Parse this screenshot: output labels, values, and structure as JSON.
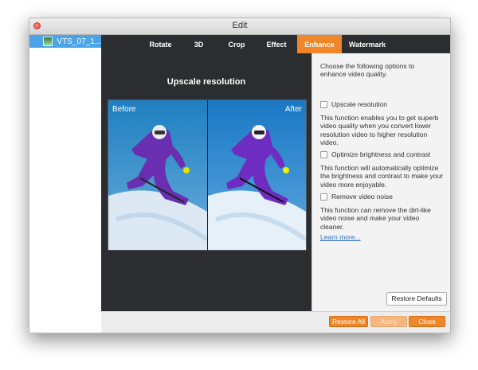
{
  "window": {
    "title": "Edit"
  },
  "sidebar": {
    "items": [
      {
        "label": "VTS_07_1..."
      }
    ]
  },
  "tabs": [
    {
      "label": "Rotate",
      "active": false
    },
    {
      "label": "3D",
      "active": false
    },
    {
      "label": "Crop",
      "active": false
    },
    {
      "label": "Effect",
      "active": false
    },
    {
      "label": "Enhance",
      "active": true
    },
    {
      "label": "Watermark",
      "active": false
    }
  ],
  "preview": {
    "title": "Upscale resolution",
    "before_label": "Before",
    "after_label": "After"
  },
  "enhance": {
    "intro": "Choose the following options to enhance video quality.",
    "options": [
      {
        "label": "Upscale resolution",
        "checked": false,
        "description": "This function enables you to get superb video quality when you convert lower resolution video to higher resolution video."
      },
      {
        "label": "Optimize brightness and contrast",
        "checked": false,
        "description": "This function will automatically optimize the brightness and contrast to make your video more enjoyable."
      },
      {
        "label": "Remove video noise",
        "checked": false,
        "description": "This function can remove the dirt-like video noise and make your video cleaner."
      }
    ],
    "learn_more": "Learn more...",
    "restore_defaults": "Restore Defaults"
  },
  "footer": {
    "restore_all": "Restore All",
    "apply": "Apply",
    "close": "Close"
  },
  "colors": {
    "accent": "#f0862a",
    "selection": "#4ba3e8",
    "dark_bg": "#2b2d30"
  }
}
